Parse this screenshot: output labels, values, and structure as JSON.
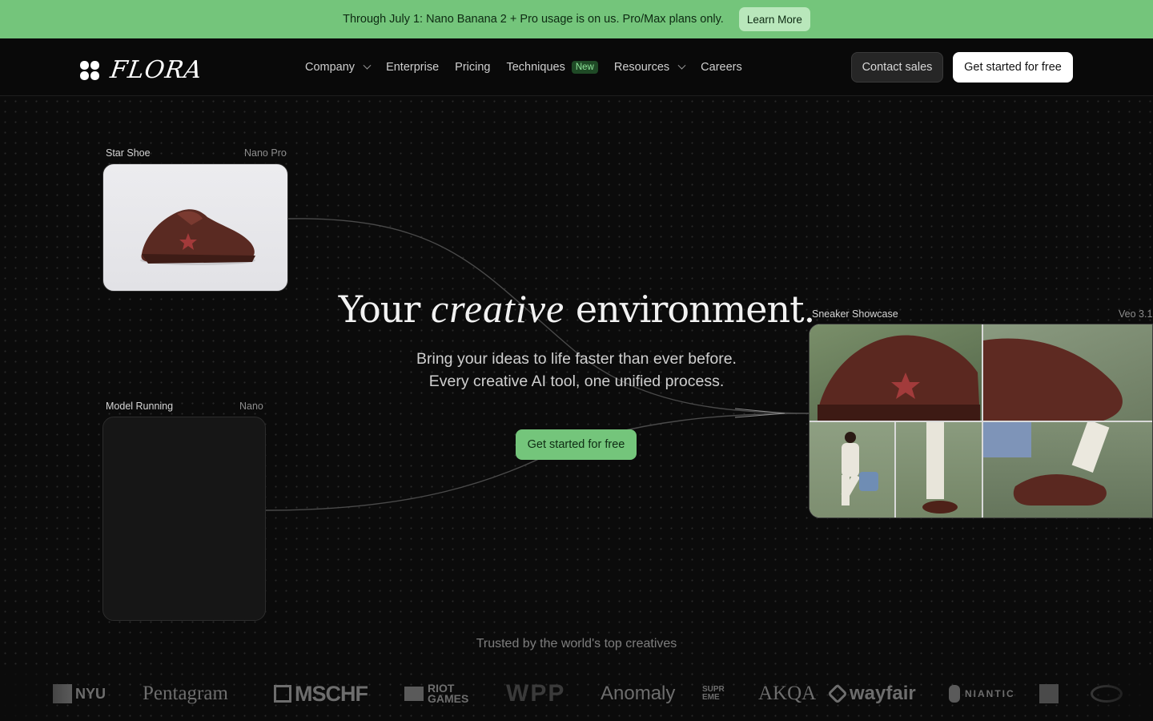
{
  "announcement": {
    "text": "Through July 1: Nano Banana 2 + Pro usage is on us. Pro/Max plans only.",
    "button": "Learn More"
  },
  "nav": {
    "logo_text": "FLORA",
    "items": [
      {
        "label": "Company",
        "dropdown": true
      },
      {
        "label": "Enterprise"
      },
      {
        "label": "Pricing"
      },
      {
        "label": "Techniques",
        "badge": "New"
      },
      {
        "label": "Resources",
        "dropdown": true
      },
      {
        "label": "Careers"
      }
    ],
    "contact": "Contact sales",
    "start": "Get started for free"
  },
  "hero": {
    "title_before": "Your",
    "title_emphasis": "creative",
    "title_after": "environment.",
    "sub_line1": "Bring your ideas to life faster than ever before.",
    "sub_line2": "Every creative AI tool, one unified process.",
    "cta": "Get started for free"
  },
  "cards": {
    "star_shoe": {
      "title": "Star Shoe",
      "model": "Nano Pro"
    },
    "model_running": {
      "title": "Model Running",
      "model": "Nano"
    },
    "showcase": {
      "title": "Sneaker Showcase",
      "model": "Veo 3.1"
    }
  },
  "trusted": {
    "label": "Trusted by the world's top creatives",
    "brands": [
      "NYU",
      "Pentagram",
      "MSCHF",
      "RIOT GAMES",
      "WPP",
      "Anomaly",
      "SUPREME",
      "AKQA",
      "wayfair",
      "NIANTIC"
    ]
  },
  "colors": {
    "accent": "#74c57b",
    "background": "#0b0b0b"
  }
}
